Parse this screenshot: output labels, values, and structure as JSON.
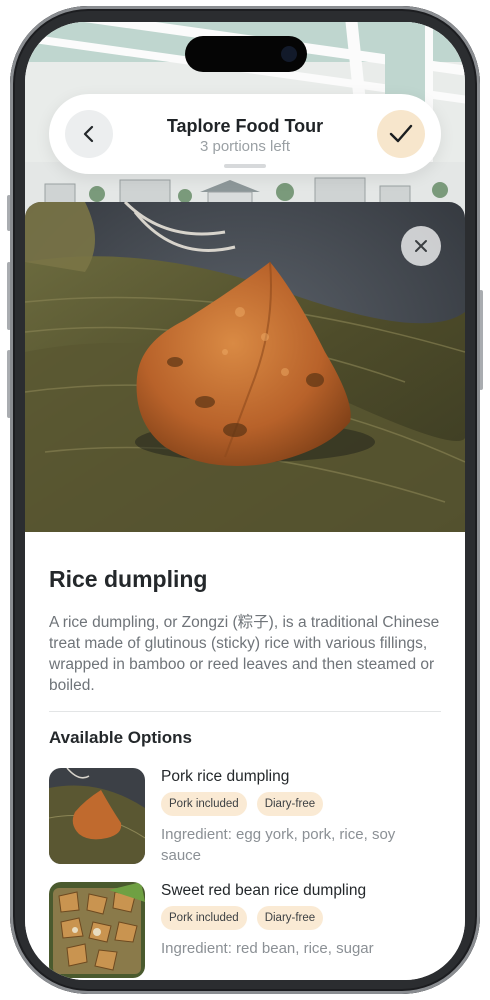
{
  "header": {
    "title": "Taplore Food Tour",
    "subtitle": "3 portions left",
    "back_icon": "chevron-left-icon",
    "confirm_icon": "check-icon"
  },
  "hero": {
    "close_icon": "close-icon"
  },
  "dish": {
    "title": "Rice dumpling",
    "description": "A rice dumpling, or Zongzi (粽子), is a traditional Chinese treat made of glutinous (sticky) rice with various fillings, wrapped in bamboo or reed leaves and then steamed or boiled."
  },
  "options": {
    "title": "Available Options",
    "items": [
      {
        "name": "Pork rice dumpling",
        "tags": [
          "Pork included",
          "Diary-free"
        ],
        "ingredient": "Ingredient: egg york, pork, rice, soy sauce"
      },
      {
        "name": "Sweet red bean rice dumpling",
        "tags": [
          "Pork included",
          "Diary-free"
        ],
        "ingredient": "Ingredient: red bean, rice, sugar"
      }
    ]
  },
  "colors": {
    "accent_soft": "#f7e6cc",
    "tag_bg": "#faead4",
    "title_text": "#24282b",
    "muted_text": "#6f7479"
  }
}
